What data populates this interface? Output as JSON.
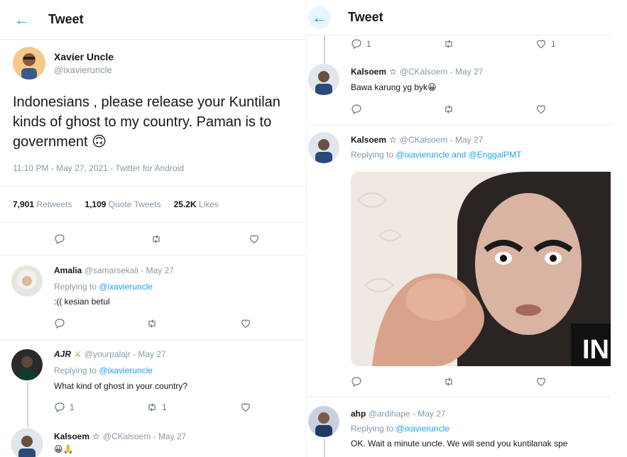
{
  "left": {
    "header": {
      "title": "Tweet"
    },
    "main_tweet": {
      "name": "Xavier Uncle",
      "handle": "@ixavieruncle",
      "text_line1": "Indonesians , please release your Kuntilan",
      "text_line2": "kinds of ghost to my country. Paman is to",
      "text_line3": "government",
      "emoji": "🙃",
      "meta": "11:10 PM - May 27, 2021 - Twitter for Android",
      "stats": {
        "retweets_value": "7,901",
        "retweets_label": "Retweets",
        "quotes_value": "1,109",
        "quotes_label": "Quote Tweets",
        "likes_value": "25.2K",
        "likes_label": "Likes"
      }
    },
    "replies": [
      {
        "name": "Amalia",
        "handle": "@samarsekali - May 27",
        "replying_prefix": "Replying to",
        "replying_to": "@ixavieruncle",
        "text": ":(( kesian betul",
        "reply_count": "",
        "rt_count": "",
        "like_count": ""
      },
      {
        "name": "AJR",
        "handle": "@yourpalajr - May 27",
        "replying_prefix": "Replying to",
        "replying_to": "@ixavieruncle",
        "text": "What kind of ghost in your country?",
        "reply_count": "1",
        "rt_count": "1",
        "like_count": ""
      },
      {
        "name": "Kalsoem",
        "handle": "@CKalsoem - May 27",
        "text": "😀🙏"
      }
    ]
  },
  "right": {
    "header": {
      "title": "Tweet"
    },
    "top_actions": {
      "reply_count": "1",
      "rt_count": "",
      "like_count": "1"
    },
    "replies": [
      {
        "name": "Kalsoem",
        "handle": "@CKalsoem - May 27",
        "text": "Bawa karung yg byk",
        "emoji": "😀"
      },
      {
        "name": "Kalsoem",
        "handle": "@CKalsoem - May 27",
        "replying_prefix": "Replying to",
        "replying_to": "@ixavieruncle and @EnggalPMT",
        "image_text": "IN"
      },
      {
        "name": "ahp",
        "handle": "@ardihape - May 27",
        "replying_prefix": "Replying to",
        "replying_to": "@ixavieruncle",
        "text": "OK. Wait a minute uncle. We will send you kuntilanak spe"
      }
    ]
  },
  "colors": {
    "accent": "#1da1f2",
    "muted": "#8899a6",
    "divider": "#e6ecf0"
  },
  "icons": [
    "back-arrow-icon",
    "reply-icon",
    "retweet-icon",
    "like-icon",
    "swords-icon",
    "star-icon"
  ]
}
